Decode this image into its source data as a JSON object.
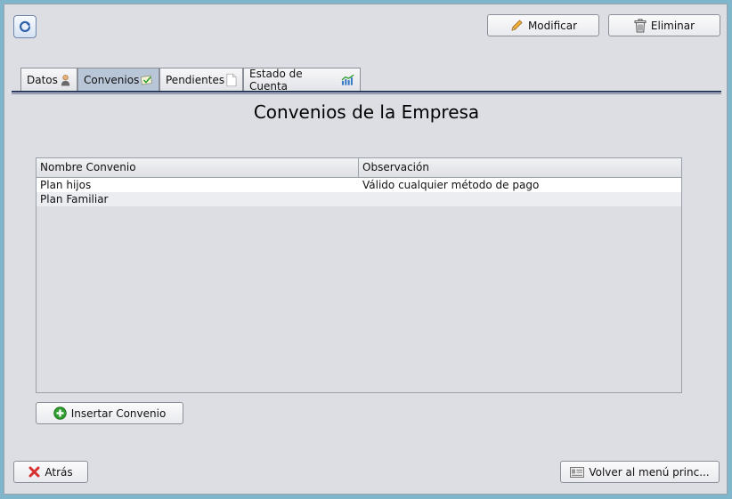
{
  "toolbar": {
    "modify_label": "Modificar",
    "delete_label": "Eliminar",
    "refresh_icon": "refresh-icon"
  },
  "tabs": [
    {
      "label": "Datos",
      "icon": "person-icon"
    },
    {
      "label": "Convenios",
      "icon": "agreement-icon",
      "active": true
    },
    {
      "label": "Pendientes",
      "icon": "document-icon"
    },
    {
      "label": "Estado de Cuenta",
      "icon": "chart-icon"
    }
  ],
  "panel": {
    "title": "Convenios de la Empresa"
  },
  "table": {
    "columns": [
      "Nombre Convenio",
      "Observación"
    ],
    "rows": [
      [
        "Plan hijos",
        "Válido cualquier método de pago"
      ],
      [
        "Plan Familiar",
        ""
      ]
    ]
  },
  "actions": {
    "insert_label": "Insertar Convenio",
    "back_label": "Atrás",
    "main_menu_label": "Volver al menú princ..."
  },
  "colors": {
    "accent_blue": "#2b3a5c",
    "active_tab": "#b8c6d8",
    "insert_green": "#2e9e2e",
    "back_red": "#d83030"
  }
}
